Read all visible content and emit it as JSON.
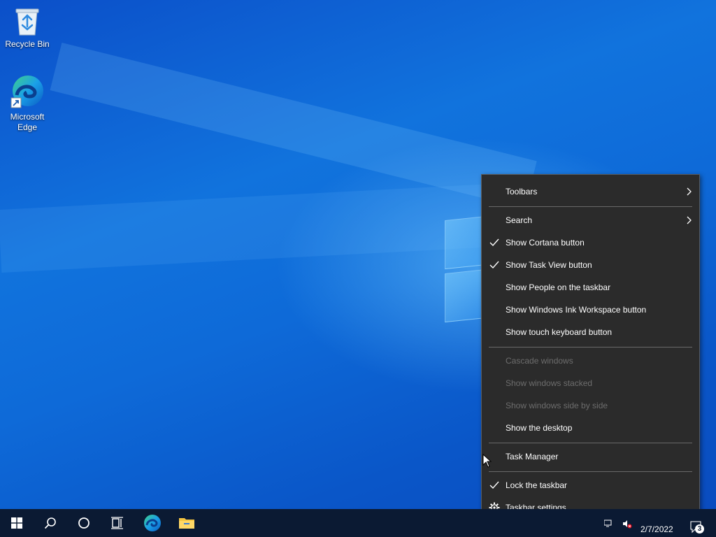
{
  "desktop": {
    "icons": [
      {
        "label": "Recycle Bin"
      },
      {
        "label": "Microsoft\nEdge"
      }
    ]
  },
  "context_menu": {
    "items": [
      {
        "label": "Toolbars",
        "checked": false,
        "submenu": true,
        "disabled": false
      },
      {
        "label": "Search",
        "checked": false,
        "submenu": true,
        "disabled": false
      },
      {
        "label": "Show Cortana button",
        "checked": true,
        "disabled": false
      },
      {
        "label": "Show Task View button",
        "checked": true,
        "disabled": false
      },
      {
        "label": "Show People on the taskbar",
        "checked": false,
        "disabled": false
      },
      {
        "label": "Show Windows Ink Workspace button",
        "checked": false,
        "disabled": false
      },
      {
        "label": "Show touch keyboard button",
        "checked": false,
        "disabled": false
      },
      {
        "label": "Cascade windows",
        "disabled": true
      },
      {
        "label": "Show windows stacked",
        "disabled": true
      },
      {
        "label": "Show windows side by side",
        "disabled": true
      },
      {
        "label": "Show the desktop",
        "disabled": false
      },
      {
        "label": "Task Manager",
        "disabled": false
      },
      {
        "label": "Lock the taskbar",
        "checked": true,
        "disabled": false
      },
      {
        "label": "Taskbar settings",
        "icon": "gear-icon",
        "disabled": false
      }
    ]
  },
  "taskbar": {
    "buttons": [
      {
        "icon": "windows-start-icon"
      },
      {
        "icon": "search-icon"
      },
      {
        "icon": "cortana-circle-icon"
      },
      {
        "icon": "task-view-icon"
      },
      {
        "icon": "edge-icon"
      },
      {
        "icon": "file-explorer-icon"
      }
    ],
    "tray": {
      "date": "2/7/2022",
      "notification_count": "3"
    }
  },
  "colors": {
    "menu_bg": "#2b2b2b",
    "menu_text": "#ffffff",
    "menu_disabled_text": "#6d6d6d",
    "taskbar_bg": "#0b1a33"
  }
}
